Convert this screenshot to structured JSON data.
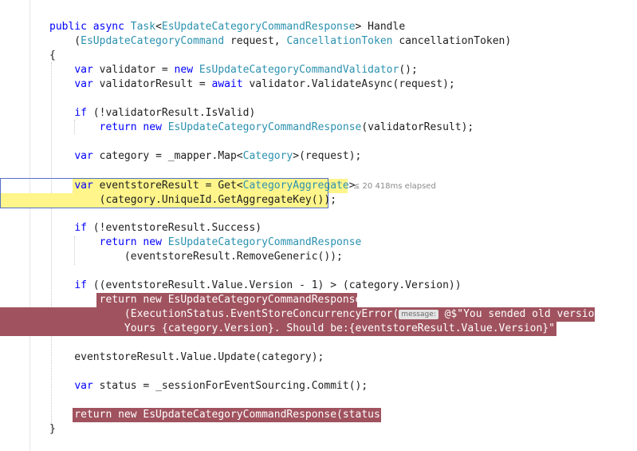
{
  "editor": {
    "elapsed_hint": "≤ 20 418ms elapsed",
    "inlay_hint": "message:",
    "lines": {
      "l1": "public async Task<EsUpdateCategoryCommandResponse> Handle",
      "l2": "    (EsUpdateCategoryCommand request, CancellationToken cancellationToken)",
      "l3": "{",
      "l4": "    var validator = new EsUpdateCategoryCommandValidator();",
      "l5": "    var validatorResult = await validator.ValidateAsync(request);",
      "l6": "    if (!validatorResult.IsValid)",
      "l7": "        return new EsUpdateCategoryCommandResponse(validatorResult);",
      "l8": "    var category = _mapper.Map<Category>(request);",
      "l9": "    var eventstoreResult = Get<CategoryAggregate>",
      "l10": "        (category.UniqueId.GetAggregateKey());",
      "l11": "    if (!eventstoreResult.Success)",
      "l12": "        return new EsUpdateCategoryCommandResponse",
      "l13": "            (eventstoreResult.RemoveGeneric());",
      "l14": "    if ((eventstoreResult.Value.Version - 1) > (category.Version))",
      "l15": "        return new EsUpdateCategoryCommandResponse",
      "l16": "            (ExecutionStatus.EventStoreConcurrencyError( @$\"You sended old version.",
      "l17": "            Yours {category.Version}. Should be:{eventstoreResult.Value.Version}\"));",
      "l18": "    eventstoreResult.Value.Update(category);",
      "l19": "    var status = _sessionForEventSourcing.Commit();",
      "l20": "    return new EsUpdateCategoryCommandResponse(status);",
      "l21": "}"
    }
  },
  "colors": {
    "keyword": "#0000ff",
    "type": "#2b91af",
    "breakpoint": "#a0535f",
    "current_statement": "#fff58a",
    "statement_border": "#5570c8"
  }
}
